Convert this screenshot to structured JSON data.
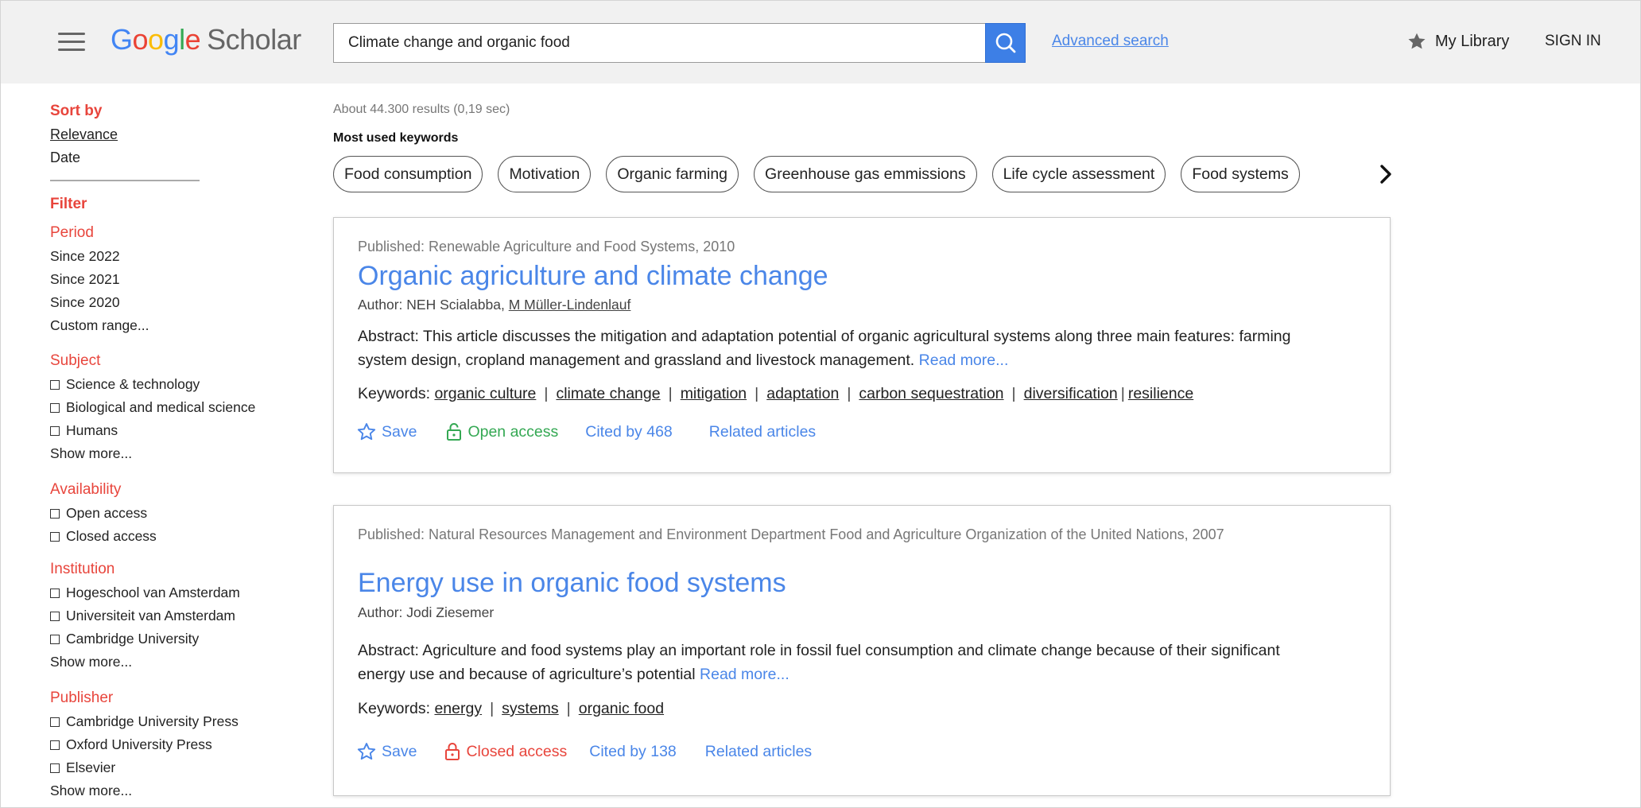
{
  "header": {
    "logo_google": [
      "G",
      "o",
      "o",
      "g",
      "l",
      "e"
    ],
    "logo_scholar": "Scholar",
    "search_value": "Climate change and organic food",
    "advanced_search": "Advanced search",
    "my_library": "My Library",
    "sign_in": "SIGN IN"
  },
  "sidebar": {
    "sort_by": "Sort by",
    "sort_options": [
      "Relevance",
      "Date"
    ],
    "filter": "Filter",
    "period": {
      "label": "Period",
      "items": [
        "Since 2022",
        "Since 2021",
        "Since 2020",
        "Custom range..."
      ]
    },
    "subject": {
      "label": "Subject",
      "items": [
        "Science & technology",
        "Biological and medical science",
        "Humans"
      ],
      "more": "Show more..."
    },
    "availability": {
      "label": "Availability",
      "items": [
        "Open access",
        "Closed access"
      ]
    },
    "institution": {
      "label": "Institution",
      "items": [
        "Hogeschool van Amsterdam",
        "Universiteit van Amsterdam",
        "Cambridge University"
      ],
      "more": "Show more..."
    },
    "publisher": {
      "label": "Publisher",
      "items": [
        "Cambridge University Press",
        "Oxford University Press",
        "Elsevier"
      ],
      "more": "Show more..."
    }
  },
  "main": {
    "results_count": "About 44.300 results (0,19 sec)",
    "keywords_title": "Most used keywords",
    "keywords": [
      "Food consumption",
      "Motivation",
      "Organic farming",
      "Greenhouse gas emmissions",
      "Life cycle assessment",
      "Food systems"
    ],
    "results": [
      {
        "published": "Published: Renewable Agriculture and Food Systems, 2010",
        "title": "Organic agriculture and climate change",
        "author_prefix": "Author: NEH Scialabba, ",
        "author_link": "M Müller-Lindenlauf",
        "abstract": "Abstract: This article discusses the mitigation and adaptation potential of organic agricultural systems along three main features: farming system design, cropland management and grassland and livestock management. ",
        "read_more": "Read more...",
        "keywords_label": "Keywords: ",
        "keywords": [
          "organic culture",
          "climate change",
          "mitigation",
          "adaptation",
          "carbon sequestration",
          "diversification",
          "resilience"
        ],
        "save": "Save",
        "access": "Open access",
        "cited": "Cited by 468",
        "related": "Related articles"
      },
      {
        "published": "Published: Natural Resources Management and Environment Department Food and Agriculture Organization of the United Nations, 2007",
        "title": "Energy use in organic food systems",
        "author_prefix": "Author: Jodi Ziesemer",
        "author_link": "",
        "abstract": "Abstract: Agriculture and food systems play an important role in fossil fuel consumption and climate change because of their significant energy use and because of agriculture’s potential ",
        "read_more": "Read more...",
        "keywords_label": "Keywords: ",
        "keywords": [
          "energy",
          "systems",
          "organic food"
        ],
        "save": "Save",
        "access": "Closed access",
        "cited": "Cited by 138",
        "related": "Related articles"
      }
    ]
  },
  "colors": {
    "accent_blue": "#4a86e8",
    "search_button": "#3d7fe6",
    "filter_red": "#e8453c",
    "open_access_green": "#34a853"
  }
}
